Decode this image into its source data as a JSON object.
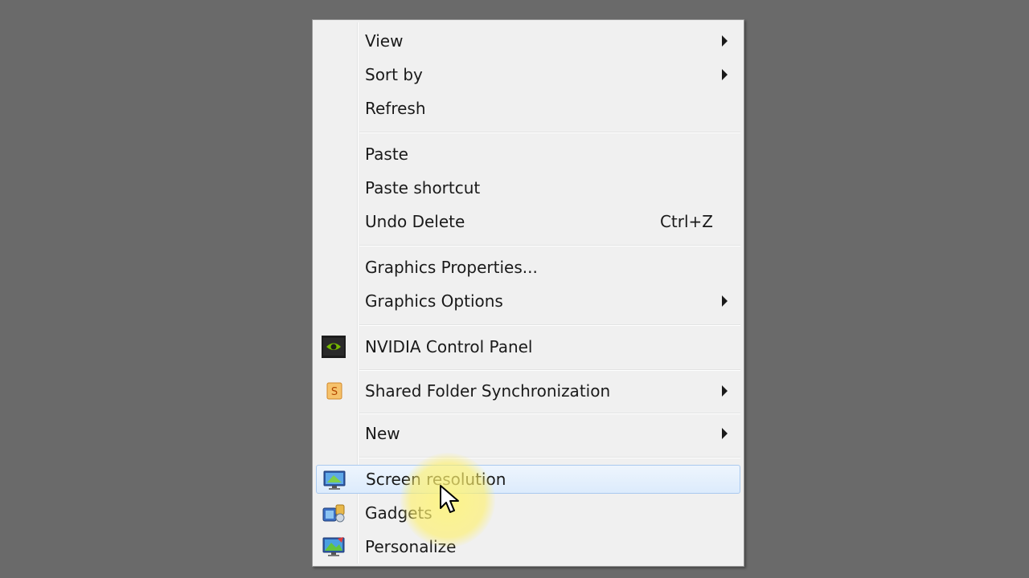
{
  "menu": {
    "items": [
      {
        "label": "View",
        "submenu": true
      },
      {
        "label": "Sort by",
        "submenu": true
      },
      {
        "label": "Refresh"
      },
      {
        "label": "Paste"
      },
      {
        "label": "Paste shortcut"
      },
      {
        "label": "Undo Delete",
        "shortcut": "Ctrl+Z"
      },
      {
        "label": "Graphics Properties..."
      },
      {
        "label": "Graphics Options",
        "submenu": true
      },
      {
        "label": "NVIDIA Control Panel",
        "icon": "nvidia-icon"
      },
      {
        "label": "Shared Folder Synchronization",
        "icon": "shared-folder-sync-icon",
        "submenu": true
      },
      {
        "label": "New",
        "submenu": true
      },
      {
        "label": "Screen resolution",
        "icon": "screen-resolution-icon",
        "highlighted": true
      },
      {
        "label": "Gadgets",
        "icon": "gadgets-icon"
      },
      {
        "label": "Personalize",
        "icon": "personalize-icon"
      }
    ]
  },
  "colors": {
    "background": "#6a6a6a",
    "menu_bg": "#f0f0f0",
    "highlight_border": "#a9c9ef",
    "cursor_glow": "#fff078"
  }
}
